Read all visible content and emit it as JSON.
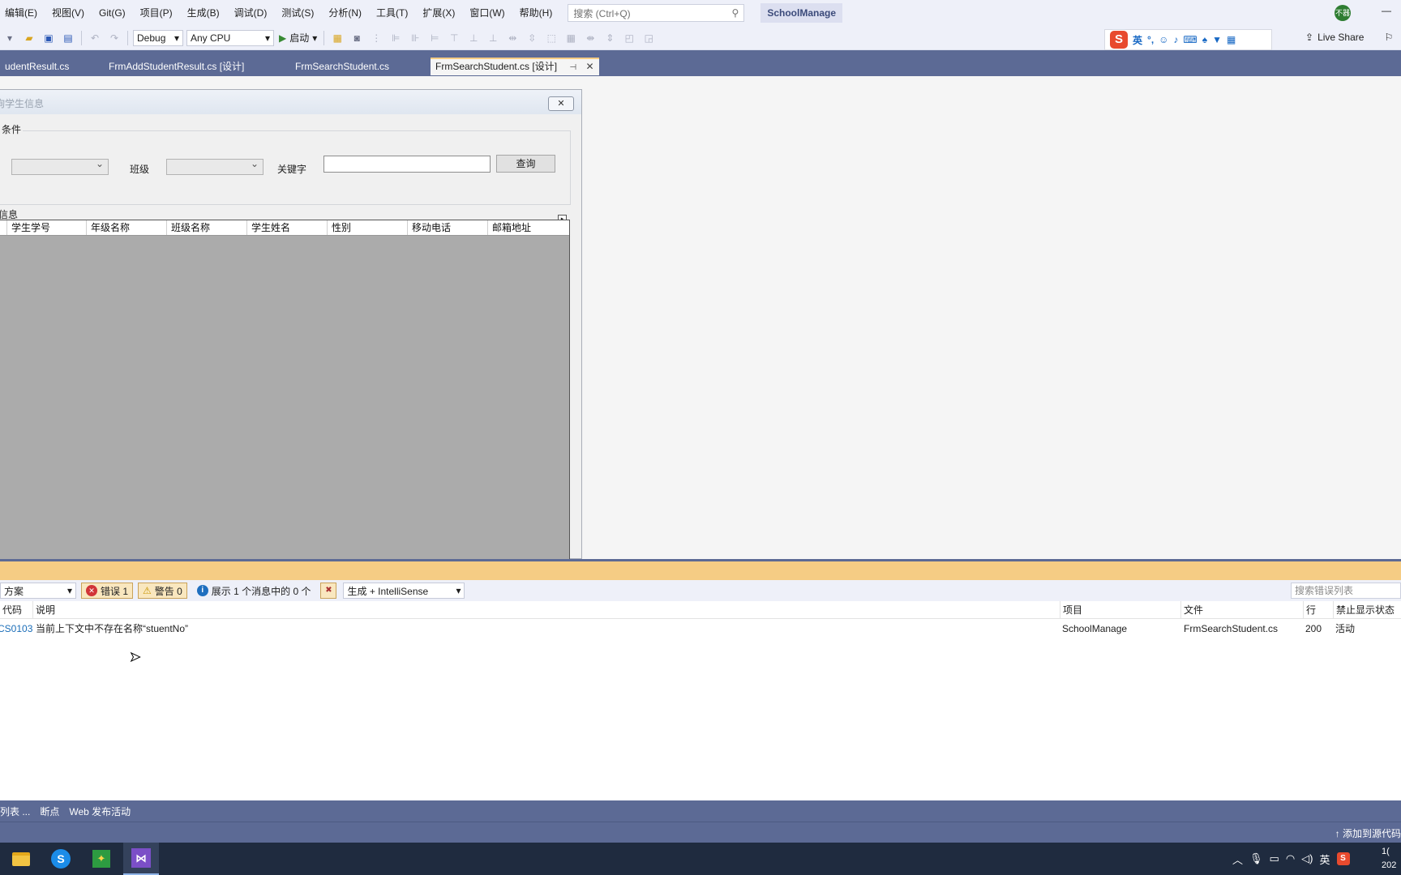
{
  "menu": [
    "编辑(E)",
    "视图(V)",
    "Git(G)",
    "项目(P)",
    "生成(B)",
    "调试(D)",
    "测试(S)",
    "分析(N)",
    "工具(T)",
    "扩展(X)",
    "窗口(W)",
    "帮助(H)"
  ],
  "search": {
    "placeholder": "搜索 (Ctrl+Q)"
  },
  "solution_name": "SchoolManage",
  "avatar_text": "不器",
  "toolbar": {
    "config": "Debug",
    "platform": "Any CPU",
    "start": "启动",
    "live_share": "Live Share"
  },
  "ime": {
    "logo": "S",
    "lang": "英"
  },
  "tabs": [
    {
      "label": "udentResult.cs"
    },
    {
      "label": "FrmAddStudentResult.cs [设计]"
    },
    {
      "label": "FrmSearchStudent.cs"
    },
    {
      "label": "FrmSearchStudent.cs [设计]"
    }
  ],
  "form": {
    "title": "询学生信息",
    "close": "✕",
    "group_query": "条件",
    "class_label": "班级",
    "keyword_label": "关键字",
    "query_button": "查询",
    "group_info": "信息",
    "columns": [
      "学生学号",
      "年级名称",
      "班级名称",
      "学生姓名",
      "性别",
      "移动电话",
      "邮箱地址"
    ]
  },
  "error_list": {
    "scope": "方案",
    "errors": "错误 1",
    "warnings": "警告 0",
    "messages": "展示 1 个消息中的 0 个",
    "build_filter": "生成 + IntelliSense",
    "search_placeholder": "搜索错误列表",
    "columns": {
      "code": "代码",
      "desc": "说明",
      "project": "项目",
      "file": "文件",
      "line": "行",
      "suppress": "禁止显示状态"
    },
    "rows": [
      {
        "code": "CS0103",
        "desc": "当前上下文中不存在名称“stuentNo”",
        "project": "SchoolManage",
        "file": "FrmSearchStudent.cs",
        "line": "200",
        "suppress": "活动"
      }
    ]
  },
  "tool_tabs": [
    "列表 ...",
    "断点",
    "Web 发布活动"
  ],
  "status": {
    "add_source": "添加到源代码"
  },
  "tray": {
    "ime": "英"
  },
  "clock": {
    "time": "1(",
    "date": "202"
  }
}
